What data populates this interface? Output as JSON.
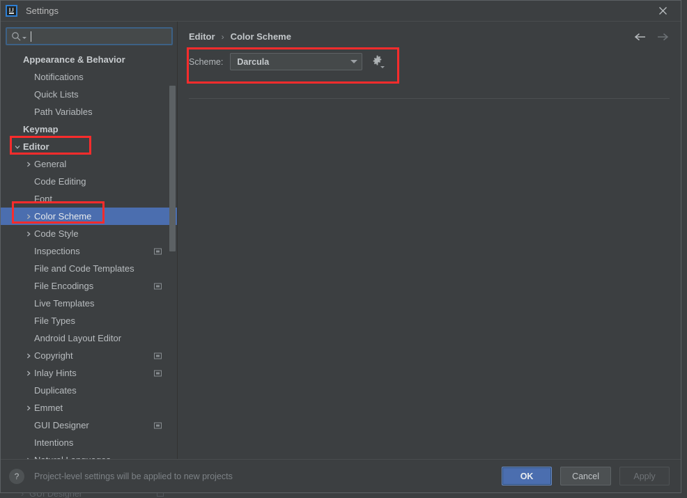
{
  "window": {
    "title": "Settings",
    "logo_icon": "intellij-idea-logo",
    "close_icon": "close-icon"
  },
  "search": {
    "icon": "search-icon",
    "value": "",
    "placeholder": ""
  },
  "sidebar": {
    "items": [
      {
        "label": "Appearance & Behavior",
        "indent": 0,
        "group": true,
        "chevron": "none",
        "badge": false,
        "selected": false
      },
      {
        "label": "Notifications",
        "indent": 1,
        "group": false,
        "chevron": "none",
        "badge": false,
        "selected": false
      },
      {
        "label": "Quick Lists",
        "indent": 1,
        "group": false,
        "chevron": "none",
        "badge": false,
        "selected": false
      },
      {
        "label": "Path Variables",
        "indent": 1,
        "group": false,
        "chevron": "none",
        "badge": false,
        "selected": false
      },
      {
        "label": "Keymap",
        "indent": 0,
        "group": true,
        "chevron": "none",
        "badge": false,
        "selected": false
      },
      {
        "label": "Editor",
        "indent": 0,
        "group": true,
        "chevron": "down",
        "badge": false,
        "selected": false
      },
      {
        "label": "General",
        "indent": 1,
        "group": false,
        "chevron": "right",
        "badge": false,
        "selected": false
      },
      {
        "label": "Code Editing",
        "indent": 1,
        "group": false,
        "chevron": "none",
        "badge": false,
        "selected": false
      },
      {
        "label": "Font",
        "indent": 1,
        "group": false,
        "chevron": "none",
        "badge": false,
        "selected": false
      },
      {
        "label": "Color Scheme",
        "indent": 1,
        "group": false,
        "chevron": "right",
        "badge": false,
        "selected": true
      },
      {
        "label": "Code Style",
        "indent": 1,
        "group": false,
        "chevron": "right",
        "badge": false,
        "selected": false
      },
      {
        "label": "Inspections",
        "indent": 1,
        "group": false,
        "chevron": "none",
        "badge": true,
        "selected": false
      },
      {
        "label": "File and Code Templates",
        "indent": 1,
        "group": false,
        "chevron": "none",
        "badge": false,
        "selected": false
      },
      {
        "label": "File Encodings",
        "indent": 1,
        "group": false,
        "chevron": "none",
        "badge": true,
        "selected": false
      },
      {
        "label": "Live Templates",
        "indent": 1,
        "group": false,
        "chevron": "none",
        "badge": false,
        "selected": false
      },
      {
        "label": "File Types",
        "indent": 1,
        "group": false,
        "chevron": "none",
        "badge": false,
        "selected": false
      },
      {
        "label": "Android Layout Editor",
        "indent": 1,
        "group": false,
        "chevron": "none",
        "badge": false,
        "selected": false
      },
      {
        "label": "Copyright",
        "indent": 1,
        "group": false,
        "chevron": "right",
        "badge": true,
        "selected": false
      },
      {
        "label": "Inlay Hints",
        "indent": 1,
        "group": false,
        "chevron": "right",
        "badge": true,
        "selected": false
      },
      {
        "label": "Duplicates",
        "indent": 1,
        "group": false,
        "chevron": "none",
        "badge": false,
        "selected": false
      },
      {
        "label": "Emmet",
        "indent": 1,
        "group": false,
        "chevron": "right",
        "badge": false,
        "selected": false
      },
      {
        "label": "GUI Designer",
        "indent": 1,
        "group": false,
        "chevron": "none",
        "badge": true,
        "selected": false
      },
      {
        "label": "Intentions",
        "indent": 1,
        "group": false,
        "chevron": "none",
        "badge": false,
        "selected": false
      },
      {
        "label": "Natural Languages",
        "indent": 1,
        "group": false,
        "chevron": "right",
        "badge": false,
        "selected": false
      }
    ]
  },
  "main": {
    "breadcrumb": {
      "parent": "Editor",
      "separator": "›",
      "current": "Color Scheme"
    },
    "nav": {
      "back_icon": "arrow-left-icon",
      "forward_icon": "arrow-right-icon"
    },
    "scheme": {
      "label": "Scheme:",
      "value": "Darcula",
      "options": [
        "Darcula"
      ],
      "gear_icon": "gear-icon"
    }
  },
  "footer": {
    "help_icon": "?",
    "note": "Project-level settings will be applied to new projects",
    "ok_label": "OK",
    "cancel_label": "Cancel",
    "apply_label": "Apply"
  },
  "background_row": {
    "label": "GUI Designer",
    "chevron": "›"
  },
  "colors": {
    "accent_blue": "#4b6eaf",
    "annotation_red": "#fb2c2c",
    "panel_bg": "#3c3f41",
    "field_bg": "#45494a"
  }
}
